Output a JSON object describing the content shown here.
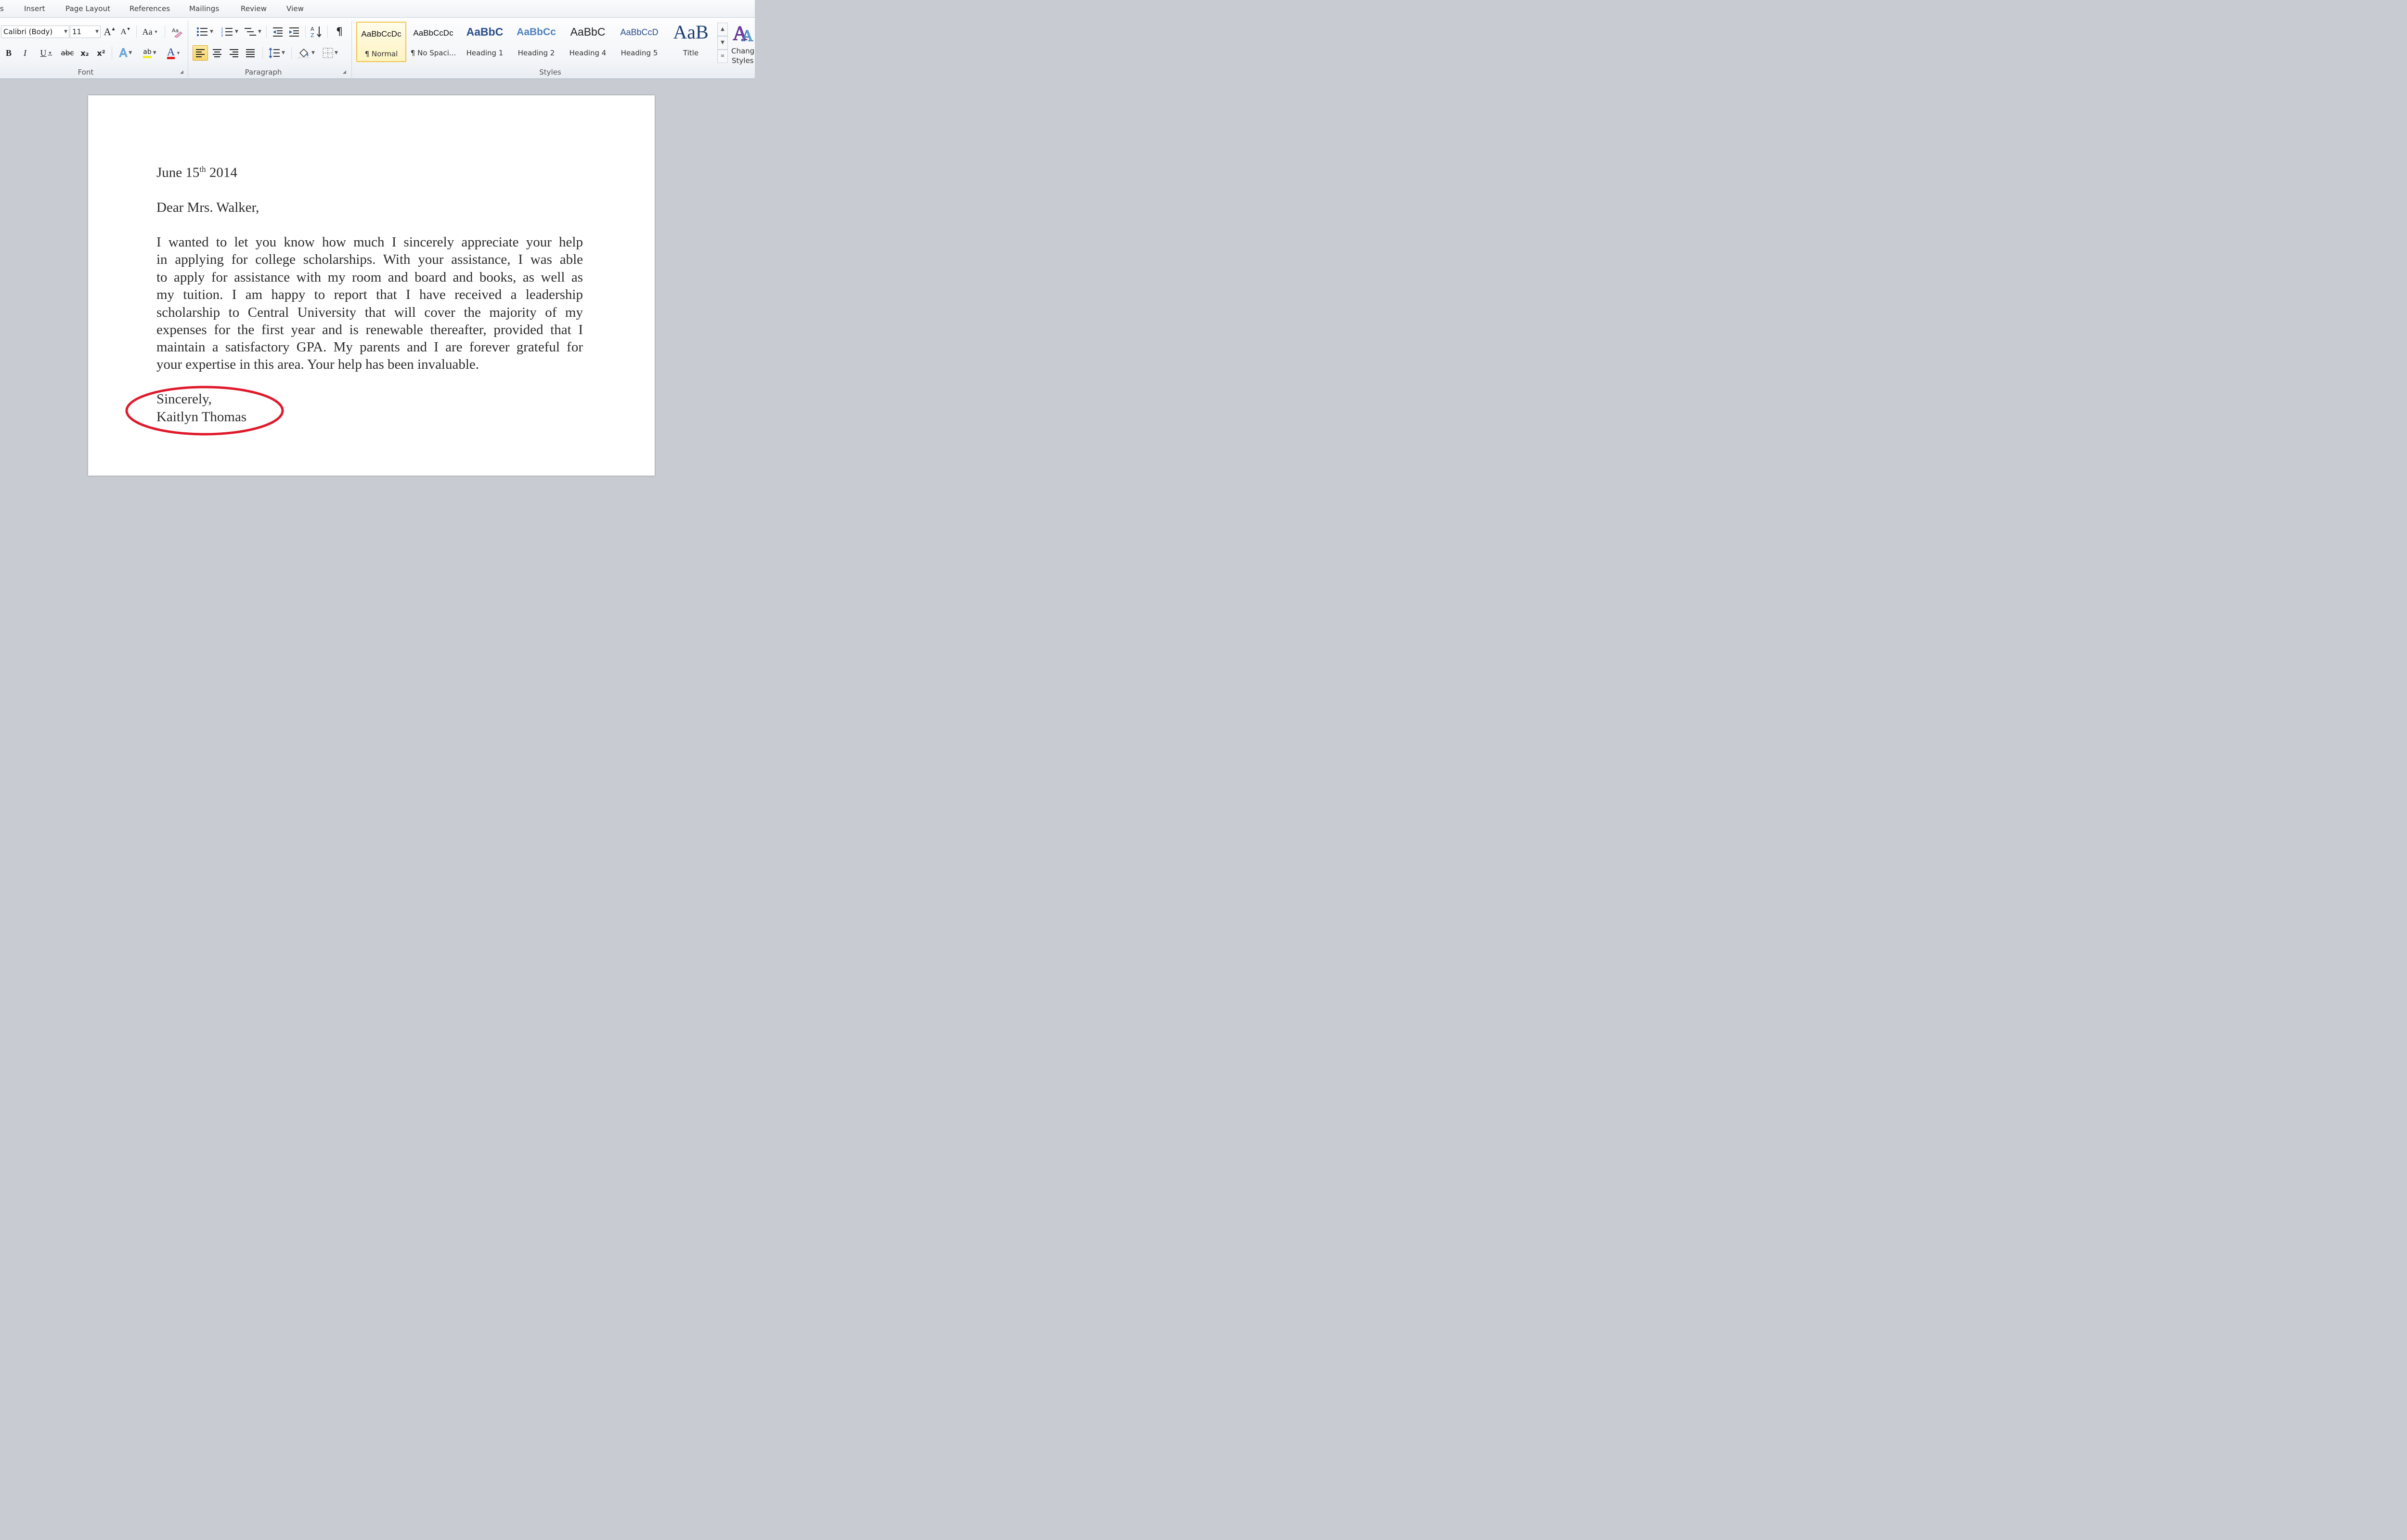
{
  "ribbon_tabs": [
    "s",
    "Insert",
    "Page Layout",
    "References",
    "Mailings",
    "Review",
    "View"
  ],
  "font_group": {
    "font_name": "Calibri (Body)",
    "font_size": "11",
    "grow_label": "A",
    "shrink_label": "A",
    "change_case_label": "Aa",
    "bold_label": "B",
    "italic_label": "I",
    "underline_label": "U",
    "strike_label": "abc",
    "subscript_label": "x₂",
    "superscript_label": "x²",
    "text_effects_label": "A",
    "highlight_label": "ab",
    "font_color_label": "A",
    "label": "Font"
  },
  "paragraph_group": {
    "label": "Paragraph",
    "pilcrow": "¶"
  },
  "styles_group": {
    "label": "Styles",
    "tiles": [
      {
        "sample": "AaBbCcDc",
        "name": "¶ Normal"
      },
      {
        "sample": "AaBbCcDc",
        "name": "¶ No Spaci..."
      },
      {
        "sample": "AaBbC",
        "name": "Heading 1"
      },
      {
        "sample": "AaBbCc",
        "name": "Heading 2"
      },
      {
        "sample": "AaBbC",
        "name": "Heading 4"
      },
      {
        "sample": "AaBbCcD",
        "name": "Heading 5"
      },
      {
        "sample": "AaB",
        "name": "Title"
      }
    ],
    "change_styles_line1": "Chang",
    "change_styles_line2": "Styles"
  },
  "colors": {
    "accent_highlight": "#f0c54b",
    "font_color_bar": "#e02020",
    "circle": "#e0192b"
  },
  "document": {
    "date_prefix": "June 15",
    "date_sup": "th",
    "date_suffix": " 2014",
    "salutation": "Dear Mrs. Walker,",
    "body_lines": [
      "I wanted to let you know how much I sincerely appreciate your help",
      "in applying for college scholarships. With your assistance, I was able",
      "to apply for assistance with my room and board and books, as well as",
      "my tuition. I am happy to report that I have received a leadership",
      "scholarship to Central University that will cover the majority of my",
      "expenses for the first year and is renewable thereafter, provided that I",
      "maintain a satisfactory GPA. My parents and I are forever grateful for",
      "your expertise in this area. Your help has been invaluable."
    ],
    "closing": "Sincerely,",
    "signature": "Kaitlyn Thomas"
  }
}
